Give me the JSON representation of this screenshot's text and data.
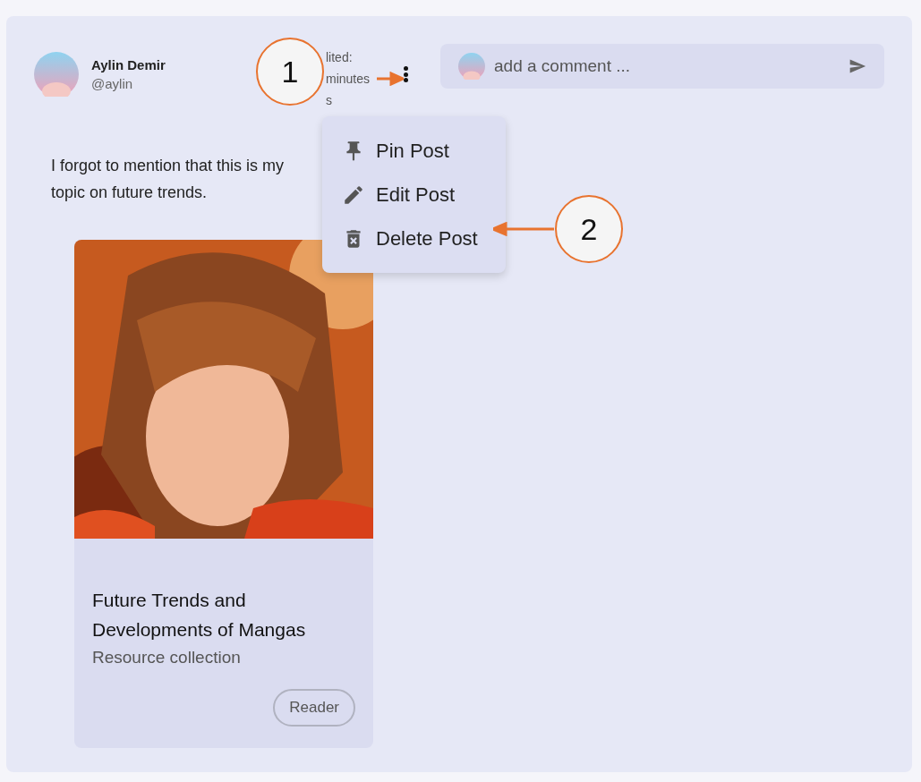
{
  "post": {
    "author": "Aylin Demir",
    "handle": "@aylin",
    "edited_lines": [
      "lited:",
      "minutes",
      "s"
    ],
    "text_lines": [
      "I forgot to mention that this is my",
      "topic on future trends."
    ],
    "comment": {
      "placeholder": "add a comment ..."
    },
    "menu": [
      {
        "kind": "pin",
        "label": "Pin Post"
      },
      {
        "kind": "edit",
        "label": "Edit Post"
      },
      {
        "kind": "delete",
        "label": "Delete Post"
      }
    ],
    "resource": {
      "title": "Future Trends and Developments of Mangas",
      "subtitle": "Resource collection",
      "tag": "Reader"
    }
  },
  "callouts": [
    "1",
    "2"
  ]
}
